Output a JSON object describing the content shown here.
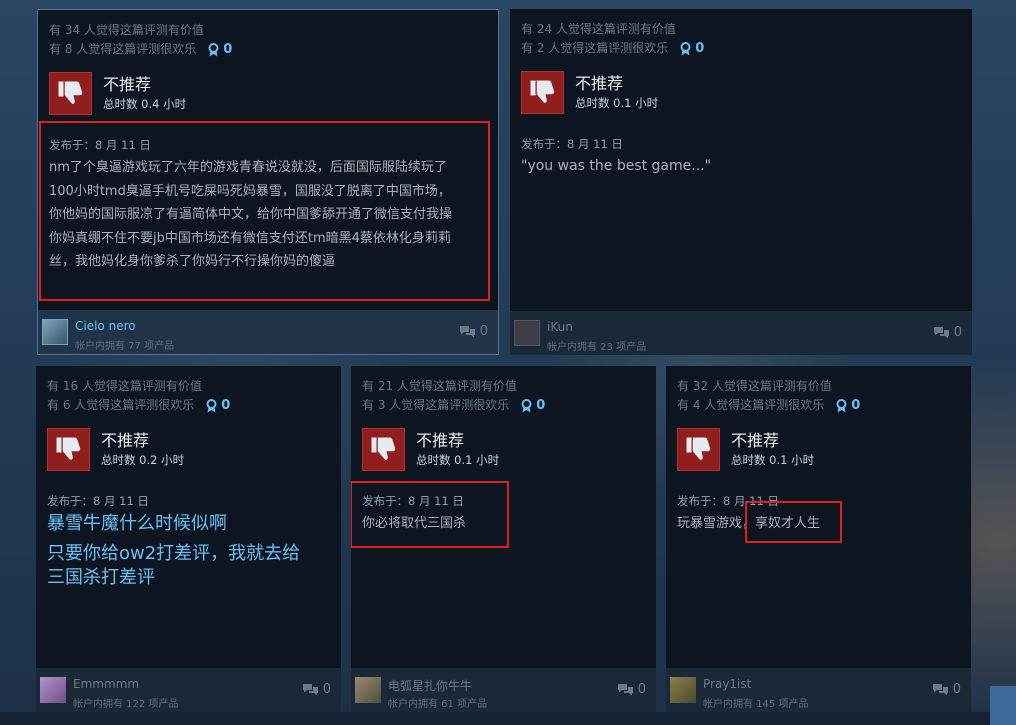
{
  "reviews": [
    {
      "helpful": "有 34 人觉得这篇评测有价值",
      "funny": "有 8 人觉得这篇评测很欢乐",
      "awards": "0",
      "verdict": "不推荐",
      "hours": "总时数 0.4 小时",
      "posted": "发布于：8 月 11 日",
      "lines": [
        "nm了个臭逼游戏玩了六年的游戏青春说没就没，后面国际服陆续玩了",
        "100小时tmd臭逼手机号吃屎吗死妈暴雪，国服没了脱离了中国市场，",
        "你他妈的国际服凉了有逼简体中文，给你中国爹舔开通了微信支付我操",
        "你妈真绷不住不要jb中国市场还有微信支付还tm暗黑4蔡依林化身莉莉",
        "丝，我他妈化身你爹杀了你妈行不行操你妈的傻逼"
      ],
      "user": "Cielo nero",
      "owned": "帐户内拥有 77 项产品",
      "comments": "0"
    },
    {
      "helpful": "有 24 人觉得这篇评测有价值",
      "funny": "有 2 人觉得这篇评测很欢乐",
      "awards": "0",
      "verdict": "不推荐",
      "hours": "总时数 0.1 小时",
      "posted": "发布于：8 月 11 日",
      "lines": [
        "\"you was the best game...\""
      ],
      "user": "iKun",
      "owned": "帐户内拥有 23 项产品",
      "comments": "0"
    },
    {
      "helpful": "有 16 人觉得这篇评测有价值",
      "funny": "有 6 人觉得这篇评测很欢乐",
      "awards": "0",
      "verdict": "不推荐",
      "hours": "总时数 0.2 小时",
      "posted": "发布于：8 月 11 日",
      "lines": [
        "暴雪牛魔什么时候似啊",
        "只要你给ow2打差评，我就去给",
        "三国杀打差评"
      ],
      "user": "Emmmmm",
      "owned": "帐户内拥有 122 项产品",
      "comments": "0"
    },
    {
      "helpful": "有 21 人觉得这篇评测有价值",
      "funny": "有 3 人觉得这篇评测很欢乐",
      "awards": "0",
      "verdict": "不推荐",
      "hours": "总时数 0.1 小时",
      "posted": "发布于：8 月 11 日",
      "lines": [
        "你必将取代三国杀"
      ],
      "user": "电弧星扎你牛牛",
      "owned": "帐户内拥有 61 项产品",
      "comments": "0"
    },
    {
      "helpful": "有 32 人觉得这篇评测有价值",
      "funny": "有 4 人觉得这篇评测很欢乐",
      "awards": "0",
      "verdict": "不推荐",
      "hours": "总时数 0.1 小时",
      "posted": "发布于：8 月 11 日",
      "lines": [
        "玩暴雪游戏，享奴才人生"
      ],
      "user": "Pray1ist",
      "owned": "帐户内拥有 145 项产品",
      "comments": "0"
    }
  ]
}
